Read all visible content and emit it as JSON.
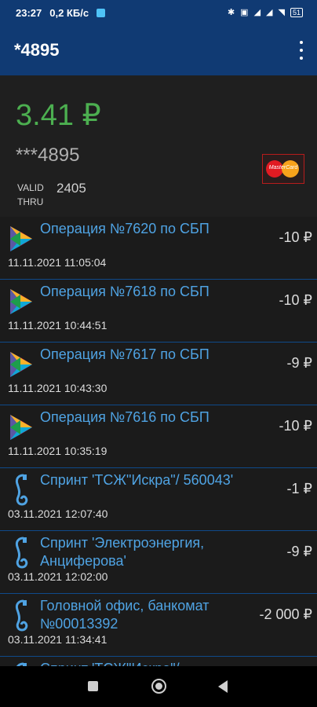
{
  "status_bar": {
    "time": "23:27",
    "speed": "0,2 КБ/с",
    "battery": "51"
  },
  "app_bar": {
    "title": "*4895"
  },
  "card": {
    "balance": "3.41 ₽",
    "number": "***4895",
    "valid_label_1": "VALID",
    "valid_label_2": "THRU",
    "valid_value": "2405",
    "brand": "MasterCard"
  },
  "transactions": [
    {
      "icon": "sbp-icon",
      "title": "Операция №7620 по СБП",
      "date": "11.11.2021 11:05:04",
      "amount": "-10 ₽"
    },
    {
      "icon": "sbp-icon",
      "title": "Операция №7618 по СБП",
      "date": "11.11.2021 10:44:51",
      "amount": "-10 ₽"
    },
    {
      "icon": "sbp-icon",
      "title": "Операция №7617 по СБП",
      "date": "11.11.2021 10:43:30",
      "amount": "-9 ₽"
    },
    {
      "icon": "sbp-icon",
      "title": "Операция №7616 по СБП",
      "date": "11.11.2021 10:35:19",
      "amount": "-10 ₽"
    },
    {
      "icon": "phone-icon",
      "title": "Спринт 'ТСЖ\"Искра\"/ 560043'",
      "date": "03.11.2021 12:07:40",
      "amount": "-1 ₽"
    },
    {
      "icon": "phone-icon",
      "title": "Спринт 'Электроэнергия, Анциферова'",
      "date": "03.11.2021 12:02:00",
      "amount": "-9 ₽"
    },
    {
      "icon": "phone-icon",
      "title": "Головной офис, банкомат №00013392",
      "date": "03.11.2021 11:34:41",
      "amount": "-2 000 ₽"
    },
    {
      "icon": "phone-icon",
      "title": "Спринт 'ТСЖ\"Искра\"/",
      "date": "",
      "amount": ""
    }
  ],
  "colors": {
    "app_bar": "#103a73",
    "balance": "#4caf50",
    "link": "#4fa3e3",
    "divider": "#0f4a8a"
  }
}
